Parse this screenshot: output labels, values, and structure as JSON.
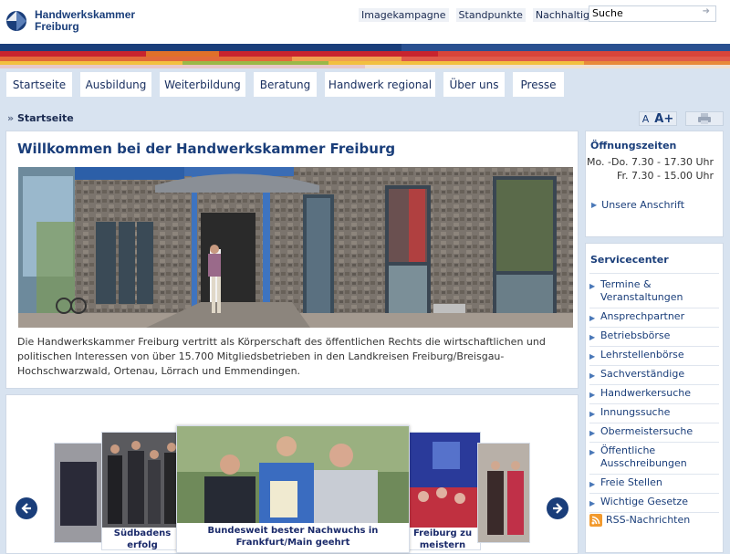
{
  "brand": {
    "line1": "Handwerkskammer",
    "line2": "Freiburg"
  },
  "toplinks": [
    "Imagekampagne",
    "Standpunkte",
    "Nachhaltigkeit"
  ],
  "search": {
    "value": "Suche"
  },
  "nav": [
    "Startseite",
    "Ausbildung",
    "Weiterbildung",
    "Beratung",
    "Handwerk regional",
    "Über uns",
    "Presse"
  ],
  "breadcrumb": {
    "arrow": "»",
    "current": "Startseite"
  },
  "font_size": {
    "small": "A",
    "large": "A+"
  },
  "welcome": {
    "title": "Willkommen bei der Handwerkskammer Freiburg",
    "text": "Die Handwerkskammer Freiburg vertritt als Körperschaft des öffentlichen Rechts die wirtschaftlichen und politischen Interessen von über 15.700 Mitgliedsbetrieben in den Landkreisen Freiburg/Breisgau-Hochschwarzwald, Ortenau, Lörrach und Emmendingen."
  },
  "slider": {
    "left_caption": "Südbadens erfolg",
    "center_caption": "Bundesweit bester Nachwuchs in Frankfurt/Main geehrt",
    "right_caption": "Freiburg zu meistern"
  },
  "hours": {
    "title": "Öffnungszeiten",
    "line1": "Mo. -Do. 7.30 - 17.30 Uhr",
    "line2": "Fr. 7.30 - 15.00 Uhr",
    "address_link": "Unsere Anschrift"
  },
  "service": {
    "title": "Servicecenter",
    "items": [
      "Termine & Veranstaltungen",
      "Ansprechpartner",
      "Betriebsbörse",
      "Lehrstellenbörse",
      "Sachverständige",
      "Handwerkersuche",
      "Innungssuche",
      "Obermeistersuche",
      "Öffentliche Ausschreibungen",
      "Freie Stellen",
      "Wichtige Gesetze",
      "RSS-Nachrichten"
    ]
  },
  "colors": {
    "brand_blue": "#1a3e7a",
    "page_bg": "#d8e3f0"
  }
}
